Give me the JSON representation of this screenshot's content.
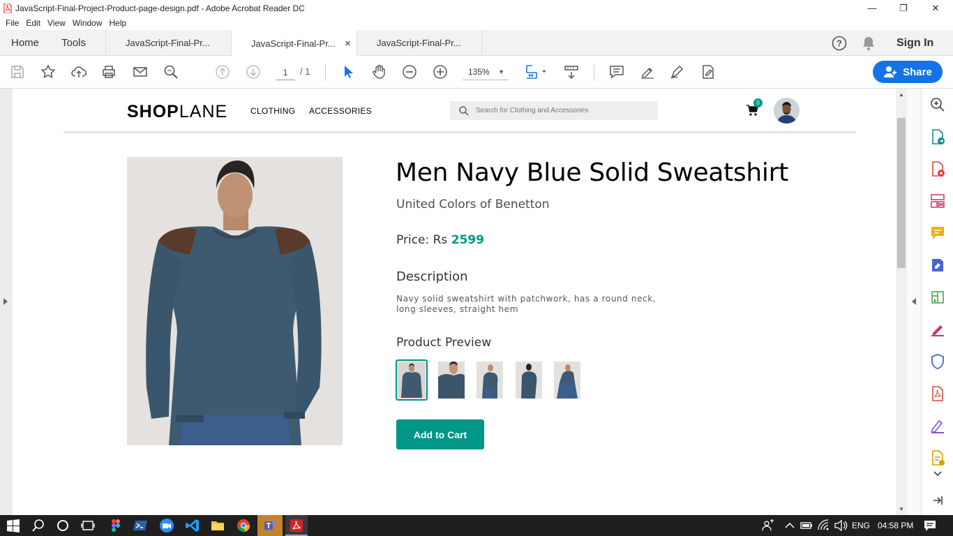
{
  "window": {
    "title": "JavaScript-Final-Project-Product-page-design.pdf - Adobe Acrobat Reader DC",
    "controls": [
      "—",
      "❐",
      "✕"
    ]
  },
  "menu": [
    "File",
    "Edit",
    "View",
    "Window",
    "Help"
  ],
  "tabs": {
    "home": "Home",
    "tools": "Tools",
    "docs": [
      "JavaScript-Final-Pr...",
      "JavaScript-Final-Pr...",
      "JavaScript-Final-Pr..."
    ],
    "close": "×",
    "sign_in": "Sign In"
  },
  "toolbar": {
    "page_current": "1",
    "page_total": "/ 1",
    "zoom": "135%",
    "share_label": "Share"
  },
  "page": {
    "logo_bold": "SHOP",
    "logo_rest": "LANE",
    "nav": [
      "CLOTHING",
      "ACCESSORIES"
    ],
    "search_placeholder": "Search for Clothing and Accessories",
    "cart_count": "0",
    "product": {
      "title": "Men Navy Blue Solid Sweatshirt",
      "brand": "United Colors of Benetton",
      "price_label": "Price: Rs ",
      "price_value": "2599",
      "description_heading": "Description",
      "description": "Navy solid sweatshirt with patchwork, has a round neck, long sleeves, straight hem",
      "preview_heading": "Product Preview",
      "preview_count": 5,
      "add_to_cart": "Add to Cart"
    },
    "accent_color": "#009688"
  },
  "taskbar": {
    "lang": "ENG",
    "time": "04:58 PM"
  }
}
